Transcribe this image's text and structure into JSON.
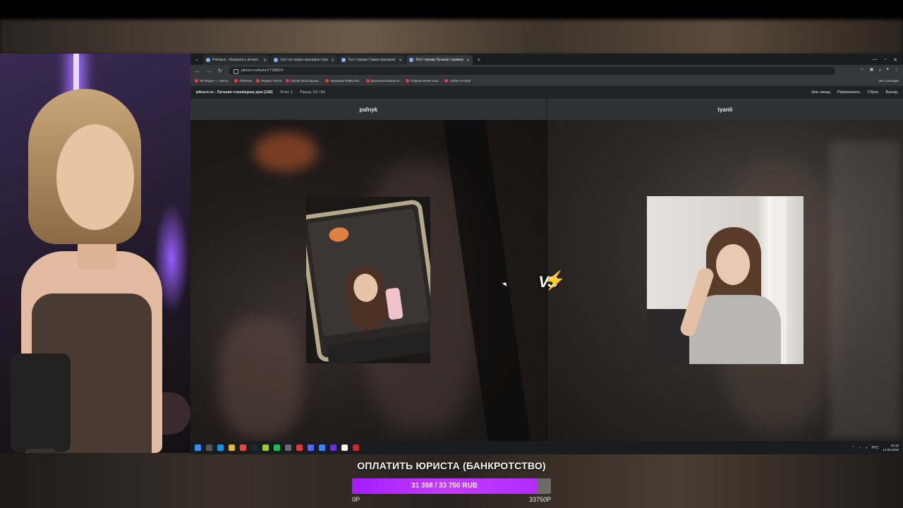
{
  "browser": {
    "tabs": [
      {
        "label": "Pointauc - Аукционы, интерс"
      },
      {
        "label": "тест на самую красивую стри"
      },
      {
        "label": "Тест-турнир Самая красивая"
      },
      {
        "label": "Тест-турнир Лучшая стример"
      }
    ],
    "url": "pikuco.ru/tests/171880/#",
    "bookmarks": [
      {
        "label": "VK Видео — смотр..."
      },
      {
        "label": "Pinterest"
      },
      {
        "label": "Яндекс Почта"
      },
      {
        "label": "Орлов Илья Бузык..."
      },
      {
        "label": "Черников Павел Ва..."
      },
      {
        "label": "Дополнительные м..."
      },
      {
        "label": "Подключение к Ба..."
      },
      {
        "label": "Adobe Acrobat"
      }
    ],
    "bookmarks_all": "Все закладки"
  },
  "site": {
    "title": "pikuco.ru - Лучшая стримерша дна (128)",
    "stage": "Этап: 1",
    "round": "Раунд: 53 / 64",
    "actions": {
      "back": "Шаг назад",
      "shuffle": "Перемешать",
      "reset": "Сброс",
      "exit": "Выход"
    }
  },
  "matchup": {
    "left_name": "pafnyk",
    "right_name": "tyanli",
    "vs_label": "VS"
  },
  "taskbar": {
    "lang": "РУС",
    "time": "20:16",
    "date": "14.05.2026"
  },
  "donation": {
    "title": "ОПЛАТИТЬ ЮРИСТА (БАНКРОТСТВО)",
    "amount_text": "31 368 / 33 750 RUB",
    "current": 31368,
    "goal": 33750,
    "min_label": "0Р",
    "max_label": "33750Р"
  },
  "colors": {
    "accent_purple": "#b22cff",
    "vs_bolt": "#f2c21b"
  }
}
